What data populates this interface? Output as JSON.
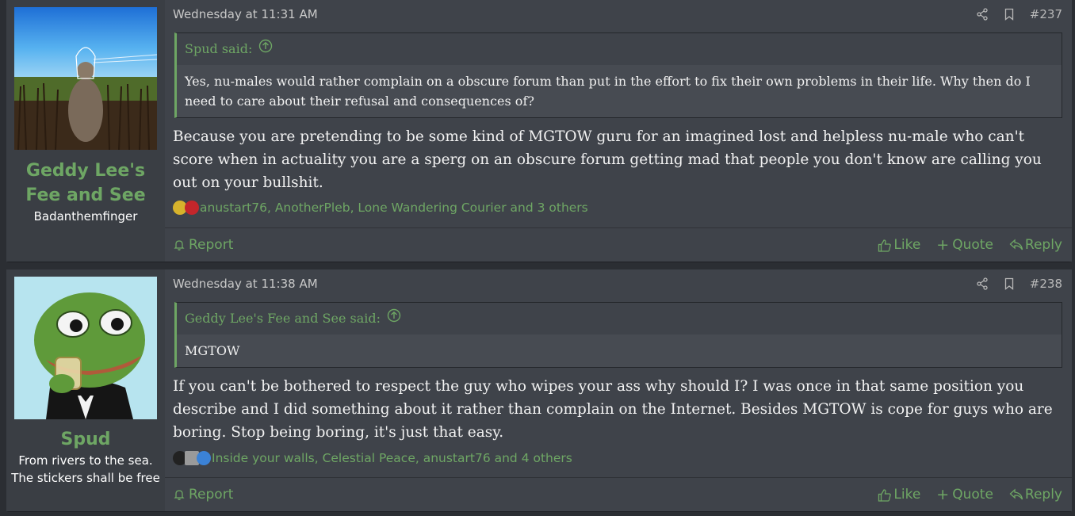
{
  "posts": [
    {
      "date": "Wednesday at 11:31 AM",
      "number": "#237",
      "user": {
        "name": "Geddy Lee's Fee and See",
        "title": "Badanthemfinger"
      },
      "quote": {
        "author_said": "Spud said:",
        "text": "Yes, nu-males would rather complain on a obscure forum than put in the effort to fix their own problems in their life. Why then do I need to care about their refusal and consequences of?"
      },
      "message": "Because you are pretending to be some kind of MGTOW guru for an imagined lost and helpless nu-male who can't score when in actuality you are a sperg on an obscure forum getting mad that people you don't know are calling you out on your bullshit.",
      "reactions": "anustart76, AnotherPleb, Lone Wandering Courier and 3 others"
    },
    {
      "date": "Wednesday at 11:38 AM",
      "number": "#238",
      "user": {
        "name": "Spud",
        "title": "From rivers to the sea. The stickers shall be free"
      },
      "quote": {
        "author_said": "Geddy Lee's Fee and See said:",
        "text": "MGTOW"
      },
      "message": "If you can't be bothered to respect the guy who wipes your ass why should I? I was once in that same position you describe and I did something about it rather than complain on the Internet. Besides MGTOW is cope for guys who are boring. Stop being boring, it's just that easy.",
      "reactions": "Inside your walls, Celestial Peace, anustart76 and 4 others"
    }
  ],
  "labels": {
    "report": "Report",
    "like": "Like",
    "quote": "Quote",
    "reply": "Reply"
  },
  "colors": {
    "accent": "#6ea664",
    "post_bg": "#3f434a",
    "user_bg": "#3a3e44",
    "page_bg": "#2b2e33"
  }
}
